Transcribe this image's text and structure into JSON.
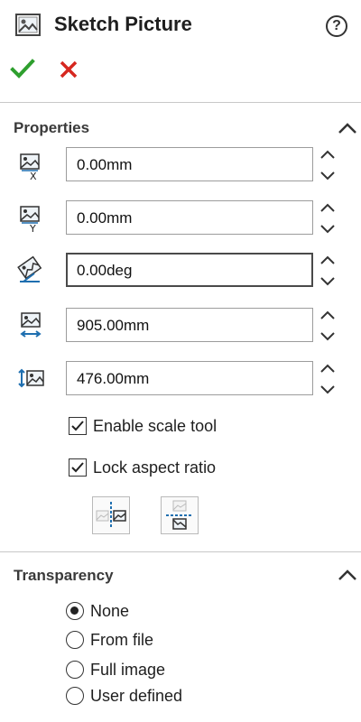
{
  "header": {
    "title": "Sketch Picture",
    "help_icon": "question-mark-icon",
    "help_glyph": "?",
    "ok_icon": "checkmark-icon",
    "cancel_icon": "close-icon",
    "ok_color": "#2e9f2e",
    "cancel_color": "#d6271f"
  },
  "properties": {
    "section_title": "Properties",
    "collapse_icon": "chevron-up-icon",
    "fields": [
      {
        "icon": "picture-origin-x-icon",
        "value": "0.00mm"
      },
      {
        "icon": "picture-origin-y-icon",
        "value": "0.00mm"
      },
      {
        "icon": "picture-rotation-icon",
        "value": "0.00deg"
      },
      {
        "icon": "picture-width-icon",
        "value": "905.00mm"
      },
      {
        "icon": "picture-height-icon",
        "value": "476.00mm"
      }
    ],
    "spinner_icon": "up-down-spinner-icon",
    "checkboxes": [
      {
        "label": "Enable scale tool",
        "checked": true
      },
      {
        "label": "Lock aspect ratio",
        "checked": true
      }
    ],
    "flip_buttons": [
      {
        "icon": "flip-horizontal-icon"
      },
      {
        "icon": "flip-vertical-icon"
      }
    ]
  },
  "transparency": {
    "section_title": "Transparency",
    "collapse_icon": "chevron-up-icon",
    "options": [
      {
        "label": "None",
        "selected": true
      },
      {
        "label": "From file",
        "selected": false
      },
      {
        "label": "Full image",
        "selected": false
      },
      {
        "label": "User defined",
        "selected": false
      }
    ]
  }
}
